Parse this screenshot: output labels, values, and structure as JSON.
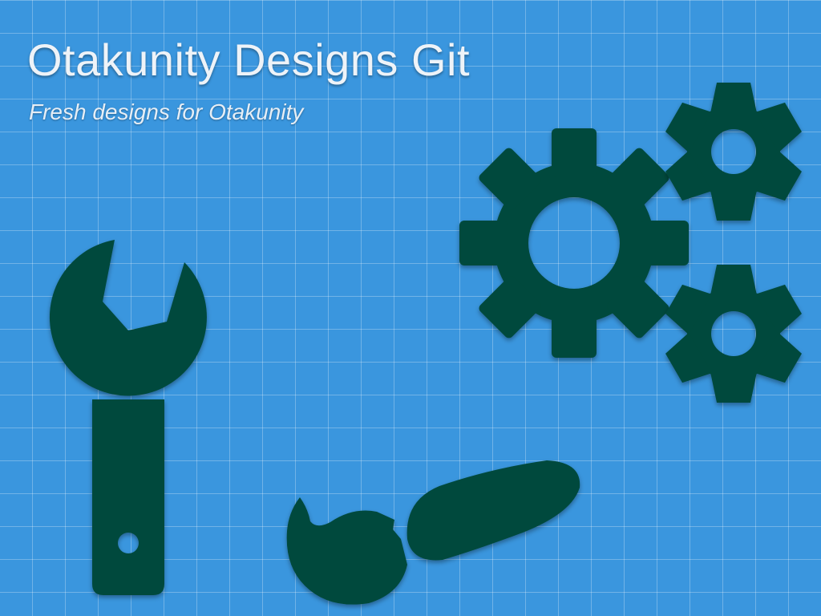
{
  "header": {
    "title": "Otakunity Designs Git",
    "subtitle": "Fresh designs for Otakunity"
  },
  "icons": [
    "wrench-icon",
    "paintbrush-icon",
    "large-gear-icon",
    "small-gear-icon",
    "small-gear-icon"
  ],
  "colors": {
    "background": "#3a96de",
    "grid_line": "#ffffff",
    "icon_fill": "#004a3c",
    "text": "#eef3f8"
  }
}
